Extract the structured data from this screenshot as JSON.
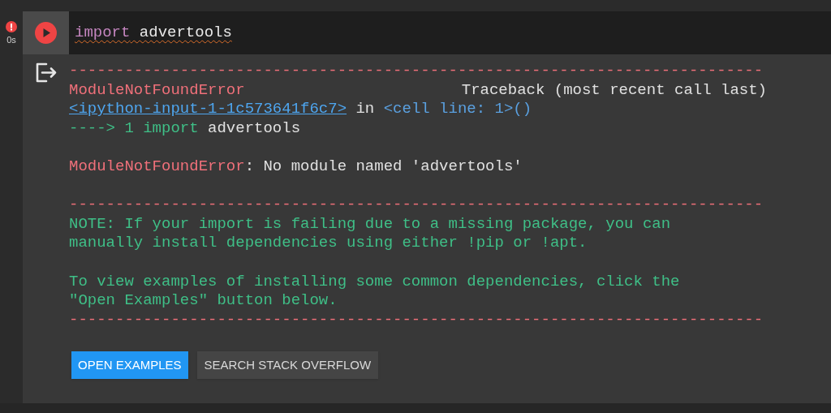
{
  "cell": {
    "status": {
      "error": true,
      "time": "0s"
    },
    "code": [
      {
        "text": "import",
        "kind": "keyword"
      },
      {
        "text": "advertools",
        "kind": "name"
      }
    ],
    "output_blocks": [
      {
        "lines": [
          [
            {
              "text": "---------------------------------------------------------------------------",
              "kind": "error"
            }
          ],
          [
            {
              "text": "ModuleNotFoundError",
              "kind": "error"
            },
            {
              "text": "Traceback (most recent call last)",
              "kind": "right"
            }
          ],
          [
            {
              "text": "<ipython-input-1-1c573641f6c7>",
              "kind": "link"
            },
            {
              "text": " in ",
              "kind": "plain"
            },
            {
              "text": "<cell line: 1>()",
              "kind": "info"
            }
          ],
          [
            {
              "text": "----> 1 import",
              "kind": "ok"
            },
            {
              "text": " advertools",
              "kind": "plain"
            }
          ]
        ]
      },
      {
        "lines": [
          [
            {
              "text": "ModuleNotFoundError",
              "kind": "error"
            },
            {
              "text": ": No module named 'advertools'",
              "kind": "plain"
            }
          ]
        ]
      },
      {
        "lines": [
          [
            {
              "text": "---------------------------------------------------------------------------",
              "kind": "error"
            }
          ],
          [
            {
              "text": "NOTE: If your import is failing due to a missing package, you can",
              "kind": "ok"
            }
          ],
          [
            {
              "text": "manually install dependencies using either !pip or !apt.",
              "kind": "ok"
            }
          ]
        ]
      },
      {
        "lines": [
          [
            {
              "text": "To view examples of installing some common dependencies, click the",
              "kind": "ok"
            }
          ],
          [
            {
              "text": "\"Open Examples\" button below.",
              "kind": "ok"
            }
          ],
          [
            {
              "text": "---------------------------------------------------------------------------",
              "kind": "error"
            }
          ]
        ]
      }
    ],
    "buttons": [
      {
        "label": "OPEN EXAMPLES",
        "primary": true
      },
      {
        "label": "SEARCH STACK OVERFLOW",
        "primary": false
      }
    ]
  }
}
